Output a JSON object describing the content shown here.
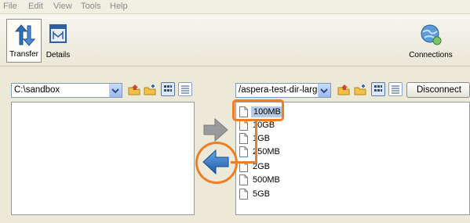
{
  "menu": {
    "items": [
      {
        "label": "File"
      },
      {
        "label": "Edit"
      },
      {
        "label": "View"
      },
      {
        "label": "Tools"
      },
      {
        "label": "Help"
      }
    ]
  },
  "toolbar": {
    "transfer_label": "Transfer",
    "details_label": "Details",
    "connections_label": "Connections",
    "active_tab": "Transfer"
  },
  "local": {
    "path": "C:\\sandbox",
    "files": []
  },
  "remote": {
    "path": "/aspera-test-dir-larg",
    "disconnect_label": "Disconnect",
    "files": [
      {
        "name": "100MB",
        "selected": true
      },
      {
        "name": "10GB"
      },
      {
        "name": "1GB"
      },
      {
        "name": "250MB"
      },
      {
        "name": "2GB"
      },
      {
        "name": "500MB"
      },
      {
        "name": "5GB"
      }
    ]
  },
  "colors": {
    "annotation": "#ee7d23",
    "download_arrow": "#2f6fb7",
    "upload_arrow_disabled": "#9a9a9a"
  }
}
